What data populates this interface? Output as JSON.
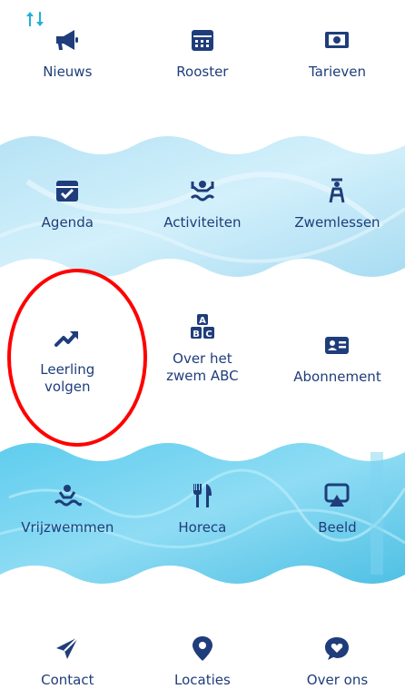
{
  "menu": [
    {
      "label": "Nieuws",
      "icon": "megaphone-icon"
    },
    {
      "label": "Rooster",
      "icon": "calendar-icon"
    },
    {
      "label": "Tarieven",
      "icon": "money-icon"
    },
    {
      "label": "Agenda",
      "icon": "calendar-check-icon"
    },
    {
      "label": "Activiteiten",
      "icon": "aqua-fitness-icon"
    },
    {
      "label": "Zwemlessen",
      "icon": "lifeguard-chair-icon"
    },
    {
      "label": "Leerling\nvolgen",
      "icon": "trend-up-icon"
    },
    {
      "label": "Over het\nzwem ABC",
      "icon": "abc-blocks-icon"
    },
    {
      "label": "Abonnement",
      "icon": "id-card-icon"
    },
    {
      "label": "Vrijzwemmen",
      "icon": "swimmer-icon"
    },
    {
      "label": "Horeca",
      "icon": "fork-knife-icon"
    },
    {
      "label": "Beeld",
      "icon": "airplay-icon"
    },
    {
      "label": "Contact",
      "icon": "send-icon"
    },
    {
      "label": "Locaties",
      "icon": "map-pin-icon"
    },
    {
      "label": "Over ons",
      "icon": "chat-heart-icon"
    }
  ],
  "colors": {
    "icon": "#1f3d7a",
    "label": "#1f3d7a",
    "water_light": "#bfe8f7",
    "water_dark": "#4fc3e6",
    "highlight_circle": "#ff0000"
  }
}
